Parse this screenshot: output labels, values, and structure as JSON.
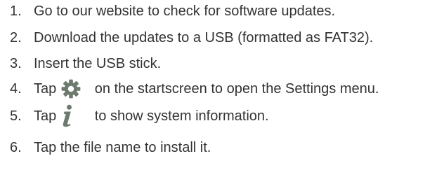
{
  "steps": [
    {
      "number": "1.",
      "text": "Go to our website to check for software updates."
    },
    {
      "number": "2.",
      "text": "Download the updates to a USB (formatted as FAT32)."
    },
    {
      "number": "3.",
      "text": "Insert the USB stick."
    },
    {
      "number": "4.",
      "before": "Tap",
      "icon": "gear-icon",
      "after": "on the startscreen to open the Settings menu."
    },
    {
      "number": "5.",
      "before": "Tap",
      "icon": "info-icon",
      "after": "to show system information."
    },
    {
      "number": "6.",
      "text": "Tap the file name to install it."
    }
  ],
  "colors": {
    "text": "#333333",
    "icon": "#6d7a6e"
  }
}
